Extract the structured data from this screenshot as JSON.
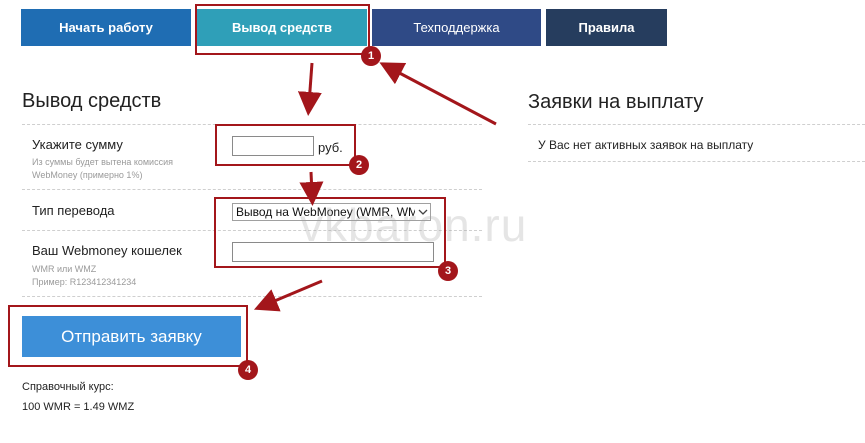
{
  "tabs": [
    {
      "label": "Начать работу"
    },
    {
      "label": "Вывод средств"
    },
    {
      "label": "Техподдержка"
    },
    {
      "label": "Правила"
    }
  ],
  "withdraw": {
    "title": "Вывод средств",
    "amount_label": "Укажите сумму",
    "amount_hint_1": "Из суммы будет вытена комиссия",
    "amount_hint_2": "WebMoney (примерно 1%)",
    "amount_value": "",
    "currency": "руб.",
    "type_label": "Тип перевода",
    "type_selected": "Вывод на WebMoney (WMR, WMZ)",
    "wallet_label": "Ваш Webmoney кошелек",
    "wallet_hint_1": "WMR или WMZ",
    "wallet_hint_2": "Пример: R123412341234",
    "wallet_value": "",
    "submit_label": "Отправить заявку",
    "rate_label": "Справочный курс:",
    "rate_value": "100 WMR = 1.49 WMZ"
  },
  "requests": {
    "title": "Заявки на выплату",
    "empty_message": "У Вас нет активных заявок на выплату"
  },
  "watermark": "vkbaron.ru",
  "annotations": {
    "badge_1": "1",
    "badge_2": "2",
    "badge_3": "3",
    "badge_4": "4"
  },
  "colors": {
    "annotation": "#a3161b",
    "tab_active": "#2f9fb8",
    "submit": "#3d8fd8"
  }
}
